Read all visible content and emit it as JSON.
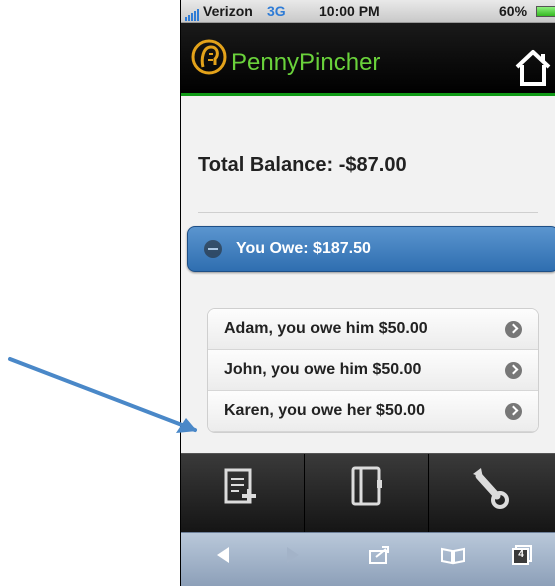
{
  "statusbar": {
    "carrier": "Verizon",
    "network": "3G",
    "time": "10:00 PM",
    "battery": "60%"
  },
  "app": {
    "name": "PennyPincher"
  },
  "balance": {
    "total_label": "Total Balance: -$87.00"
  },
  "owe_section": {
    "label": "You Owe: $187.50",
    "expanded": true,
    "items": [
      {
        "text": "Adam, you owe him $50.00"
      },
      {
        "text": "John, you owe him $50.00"
      },
      {
        "text": "Karen, you owe her $50.00"
      }
    ]
  },
  "toolbar": {
    "buttons": [
      "new-entry-icon",
      "contacts-book-icon",
      "wrench-settings-icon"
    ]
  },
  "browser": {
    "tabs_count": "4"
  },
  "colors": {
    "header_bg": "#000000",
    "brand_green": "#6ad23b",
    "accent_blue": "#3a78bd",
    "annotation_arrow": "#4a88c8"
  }
}
